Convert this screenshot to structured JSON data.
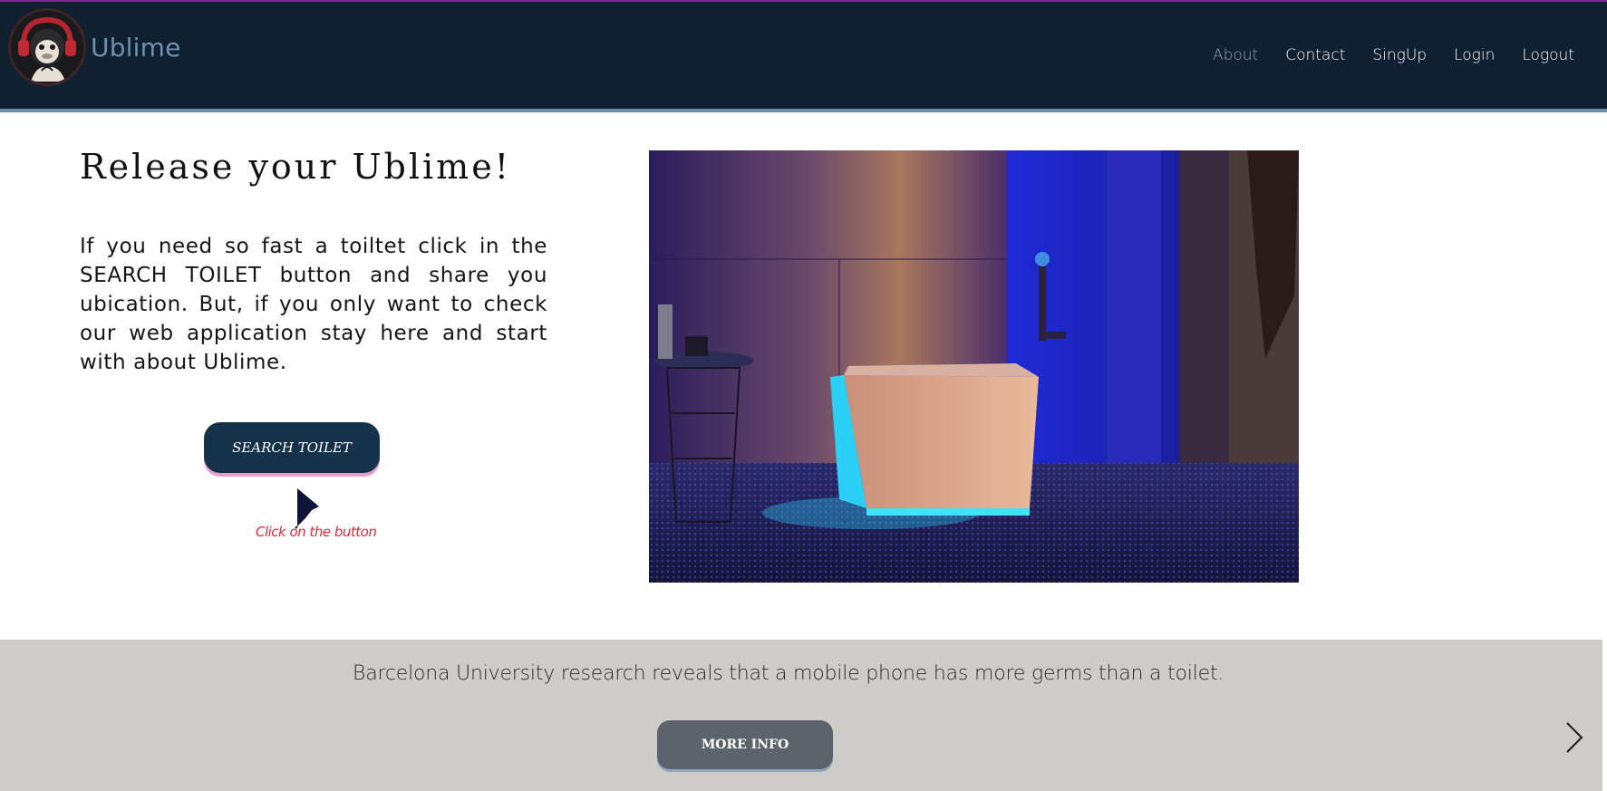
{
  "header": {
    "brand": "Ublime",
    "nav": [
      {
        "label": "About",
        "active": true
      },
      {
        "label": "Contact"
      },
      {
        "label": "SingUp"
      },
      {
        "label": "Login"
      },
      {
        "label": "Logout"
      }
    ]
  },
  "hero": {
    "title": "Release your Ublime!",
    "text": "If you need so fast a toiltet click in the SEARCH TOILET button and share you ubication. But, if you only want to check our web application stay here and start with about Ublime.",
    "search_button": "SEARCH TOILET",
    "hint": "Click on the button"
  },
  "strip": {
    "fact": "Barcelona University research reveals that a mobile phone has more germs than a toilet.",
    "more_button": "MORE INFO"
  },
  "colors": {
    "header_bg": "#102030",
    "brand": "#6f90ad",
    "search_button": "#14324a",
    "hint": "#e0283a",
    "strip_bg": "#cdccc8",
    "more_button": "#5c636b"
  },
  "icons": {
    "logo": "monkey-headphones-logo",
    "cursor": "arrow-cursor-icon",
    "next": "chevron-right-icon"
  }
}
